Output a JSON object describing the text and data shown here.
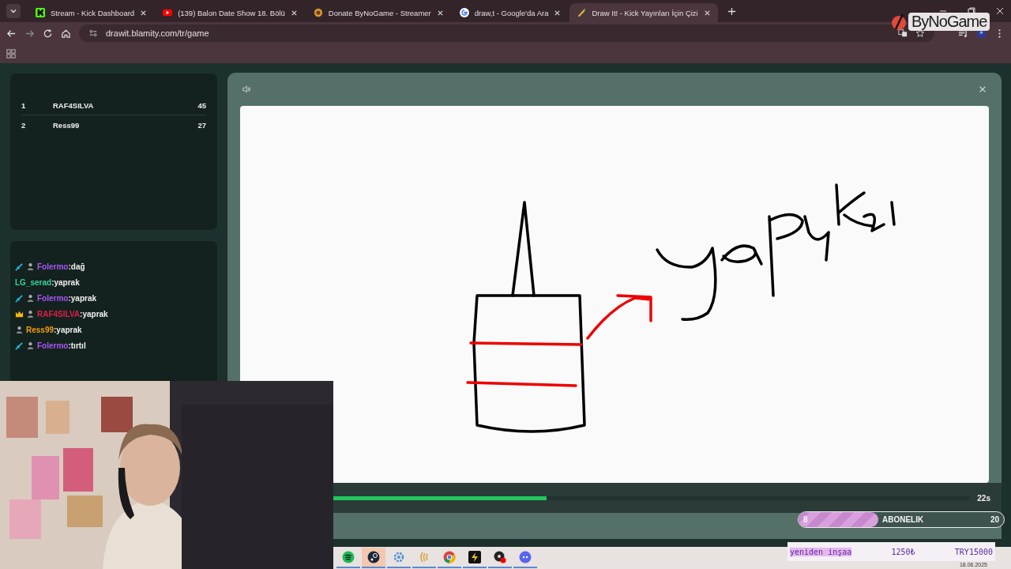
{
  "browser": {
    "tabs": [
      {
        "title": "Stream - Kick Dashboard",
        "kind": "kick",
        "selected": false
      },
      {
        "title": "(139) Balon Date Show 18. Bölü",
        "kind": "youtube",
        "selected": false
      },
      {
        "title": "Donate ByNoGame - Streamer",
        "kind": "bynogame",
        "selected": false
      },
      {
        "title": "draw,t - Google'da Ara",
        "kind": "google",
        "selected": false
      },
      {
        "title": "Draw It! - Kick Yayınları İçin Çizi",
        "kind": "drawit",
        "selected": true
      }
    ],
    "url": "drawit.blamity.com/tr/game"
  },
  "overlay_logo": {
    "text": "ByNoGame"
  },
  "leaderboard": [
    {
      "rank": "1",
      "name": "RAF4SILVA",
      "score": "45"
    },
    {
      "rank": "2",
      "name": "Ress99",
      "score": "27"
    }
  ],
  "chat": [
    {
      "kind": "vip",
      "user": "Folermo",
      "color": "#a855f7",
      "message": ":dağ"
    },
    {
      "kind": "plain",
      "user": "LG_serad",
      "color": "#34d399",
      "message": ":yaprak"
    },
    {
      "kind": "vip",
      "user": "Folermo",
      "color": "#a855f7",
      "message": ":yaprak"
    },
    {
      "kind": "crowned",
      "user": "RAF4SILVA",
      "color": "#e11d48",
      "message": ":yaprak"
    },
    {
      "kind": "member",
      "user": "Ress99",
      "color": "#f59e0b",
      "message": ":yaprak"
    },
    {
      "kind": "vip",
      "user": "Folermo",
      "color": "#a855f7",
      "message": ":tırtıl"
    }
  ],
  "game": {
    "timer": {
      "level": 0.42,
      "reading": "22s"
    }
  },
  "goal": {
    "current": "8",
    "label": "ABONELIK",
    "target": "20",
    "level": 0.39
  },
  "donation": {
    "message": "yeniden inşaa",
    "amount": "1250₺",
    "total": "TRY15000"
  },
  "taskbar": {
    "apps": [
      {
        "kind": "spotify",
        "selected": false
      },
      {
        "kind": "steam",
        "selected": true
      },
      {
        "kind": "gear",
        "selected": false
      },
      {
        "kind": "waves",
        "selected": false
      },
      {
        "kind": "chrome",
        "selected": false
      },
      {
        "kind": "bolt",
        "selected": false
      },
      {
        "kind": "record",
        "selected": false
      },
      {
        "kind": "discord",
        "selected": false
      }
    ],
    "date": "18.06.2025"
  }
}
